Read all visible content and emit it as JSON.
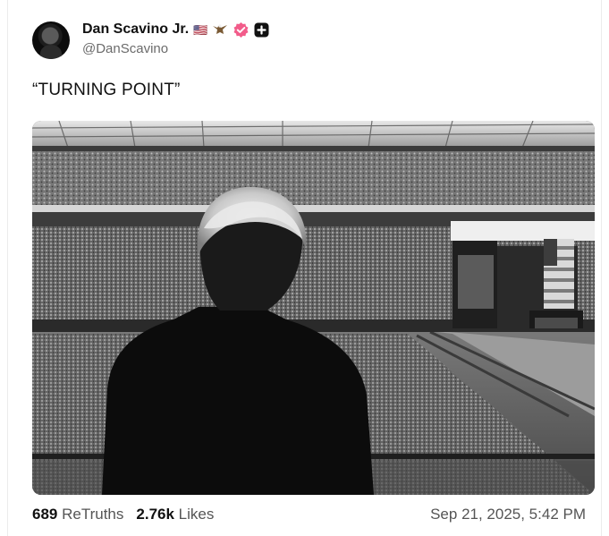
{
  "author": {
    "display_name": "Dan Scavino Jr.",
    "name_emoji": "🇺🇸",
    "handle": "@DanScavino",
    "verified_color": "#f25c8a"
  },
  "post": {
    "text": "“TURNING POINT”"
  },
  "stats": {
    "retruths_count": "689",
    "retruths_label": "ReTruths",
    "likes_count": "2.76k",
    "likes_label": "Likes"
  },
  "timestamp": "Sep 21, 2025, 5:42 PM",
  "icons": {
    "flag": "us-flag-icon",
    "eagle": "eagle-icon",
    "verified": "verified-badge-icon",
    "plus": "plus-badge-icon"
  }
}
